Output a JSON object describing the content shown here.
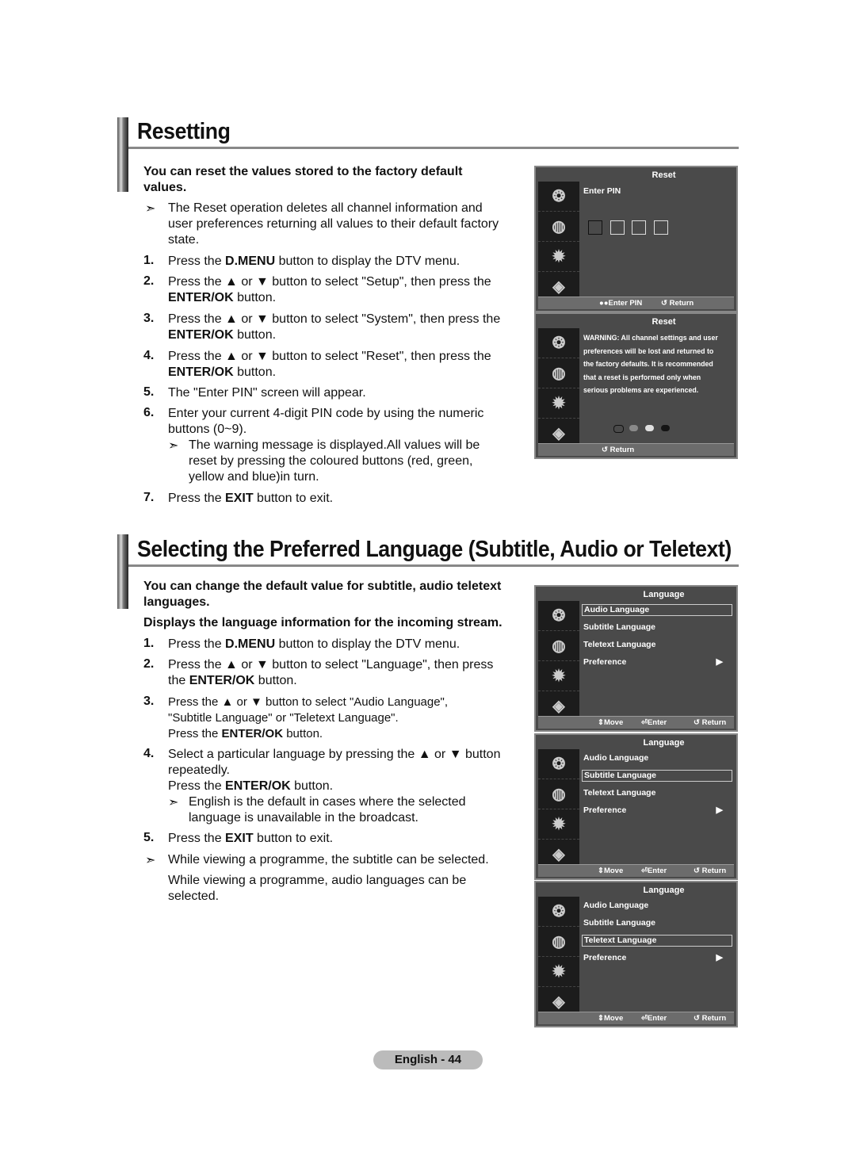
{
  "section1": {
    "title": "Resetting",
    "intro": "You can reset the values stored to the factory default values.",
    "note": "The Reset operation deletes all channel information and user preferences returning all values to their default factory state.",
    "steps": [
      {
        "n": "1.",
        "pre": "Press the ",
        "bold": "D.MENU",
        "post": " button to display the DTV menu."
      },
      {
        "n": "2.",
        "pre": "Press the ▲ or ▼ button to select \"Setup\", then press the ",
        "bold": "ENTER/OK",
        "post": " button."
      },
      {
        "n": "3.",
        "pre": "Press the ▲ or ▼ button to select \"System\", then press the ",
        "bold": "ENTER/OK",
        "post": " button."
      },
      {
        "n": "4.",
        "pre": "Press the ▲ or ▼ button to select \"Reset\", then press the ",
        "bold": "ENTER/OK",
        "post": " button."
      },
      {
        "n": "5.",
        "pre": "The \"Enter PIN\" screen will appear.",
        "bold": "",
        "post": ""
      },
      {
        "n": "6.",
        "pre": "Enter your current 4-digit PIN code by using the numeric buttons (0~9).",
        "bold": "",
        "post": ""
      },
      {
        "n": "7.",
        "pre": "Press the ",
        "bold": "EXIT",
        "post": " button to exit."
      }
    ],
    "step6_note": "The warning message is displayed.All values will be reset by pressing the coloured buttons (red, green, yellow and blue)in turn."
  },
  "osd_reset_pin": {
    "title": "Reset",
    "label": "Enter PIN",
    "pin_boxes": 4,
    "footer_enter": "●●Enter PIN",
    "footer_return": "↺ Return"
  },
  "osd_reset_warning": {
    "title": "Reset",
    "warning_lines": [
      "WARNING: All channel settings and user",
      "preferences will be lost and returned to",
      "the factory defaults. It is recommended",
      "that a reset is performed only when",
      "serious problems are experienced."
    ],
    "dot_colors": [
      "#4a4a4a",
      "#8a8a8a",
      "#e0e0e0",
      "#151515"
    ],
    "footer_return": "↺ Return"
  },
  "section2": {
    "title": "Selecting the Preferred Language (Subtitle, Audio or Teletext)",
    "intro1": "You can change the default value for subtitle, audio teletext languages.",
    "intro2": "Displays the language information for the incoming stream.",
    "step1": {
      "n": "1.",
      "pre": "Press the ",
      "bold": "D.MENU",
      "post": " button to display the DTV menu."
    },
    "step2": {
      "n": "2.",
      "pre": "Press the ▲ or ▼ button to select \"Language\", then press the ",
      "bold": "ENTER/OK",
      "post": " button."
    },
    "step3": {
      "n": "3.",
      "line1": "Press the ▲ or ▼ button to select \"Audio Language\",",
      "line2": "\"Subtitle Language\" or \"Teletext Language\".",
      "line3_pre": "Press the ",
      "line3_bold": "ENTER/OK",
      "line3_post": " button."
    },
    "step4": {
      "n": "4.",
      "line1": "Select a particular language by pressing the ▲ or ▼ button repeatedly.",
      "line2_pre": "Press the ",
      "line2_bold": "ENTER/OK",
      "line2_post": " button.",
      "note": "English is the default in cases where the selected language is unavailable in the broadcast."
    },
    "step5": {
      "n": "5.",
      "pre": "Press the ",
      "bold": "EXIT",
      "post": " button to exit."
    },
    "note1": "While viewing a programme, the subtitle can be selected.",
    "note2": "While viewing a programme, audio languages can be selected."
  },
  "osd_language": {
    "title": "Language",
    "items": [
      "Audio Language",
      "Subtitle Language",
      "Teletext Language",
      "Preference"
    ],
    "footer_move": "⇕Move",
    "footer_enter": "⏎Enter",
    "footer_return": "↺ Return"
  },
  "footer": {
    "page_label": "English - 44"
  },
  "glyphs": {
    "arrow": "➣",
    "right": "▶"
  }
}
